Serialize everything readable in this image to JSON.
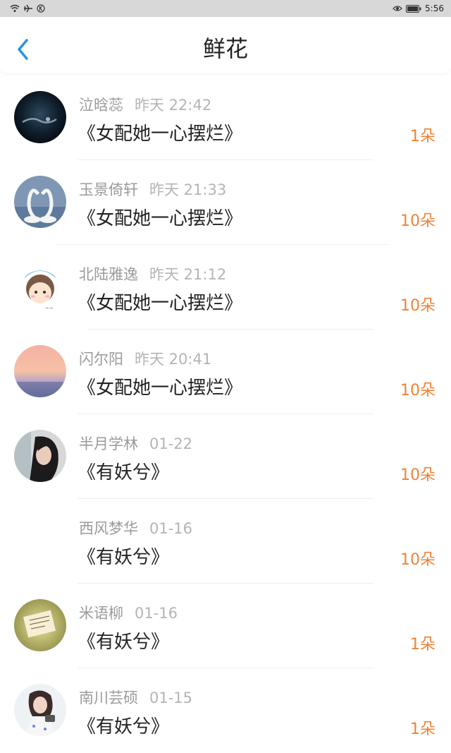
{
  "status_bar": {
    "time": "5:56",
    "icons_left": [
      "wifi-icon",
      "airplane-icon",
      "k-badge-icon"
    ],
    "icons_right": [
      "eye-icon",
      "battery-icon"
    ]
  },
  "header": {
    "title": "鲜花",
    "back_icon": "chevron-left-icon",
    "accent": "#2d8fe0"
  },
  "colors": {
    "count": "#f08236",
    "name": "#9a9a9a",
    "time": "#b4b4b4"
  },
  "items": [
    {
      "name": "泣晗蕊",
      "time": "昨天 22:42",
      "book": "《女配她一心摆烂》",
      "count": "1朵",
      "avatar": "night-sky-avatar"
    },
    {
      "name": "玉景倚轩",
      "time": "昨天 21:33",
      "book": "《女配她一心摆烂》",
      "count": "10朵",
      "avatar": "swans-avatar"
    },
    {
      "name": "北陆雅逸",
      "time": "昨天 21:12",
      "book": "《女配她一心摆烂》",
      "count": "10朵",
      "avatar": "cartoon-avatar"
    },
    {
      "name": "闪尔阳",
      "time": "昨天 20:41",
      "book": "《女配她一心摆烂》",
      "count": "10朵",
      "avatar": "sunset-avatar"
    },
    {
      "name": "半月学林",
      "time": "01-22",
      "book": "《有妖兮》",
      "count": "10朵",
      "avatar": "portrait-avatar"
    },
    {
      "name": "西风梦华",
      "time": "01-16",
      "book": "《有妖兮》",
      "count": "10朵",
      "avatar": "none"
    },
    {
      "name": "米语柳",
      "time": "01-16",
      "book": "《有妖兮》",
      "count": "1朵",
      "avatar": "note-avatar"
    },
    {
      "name": "南川芸硕",
      "time": "01-15",
      "book": "《有妖兮》",
      "count": "1朵",
      "avatar": "girl-avatar"
    }
  ]
}
